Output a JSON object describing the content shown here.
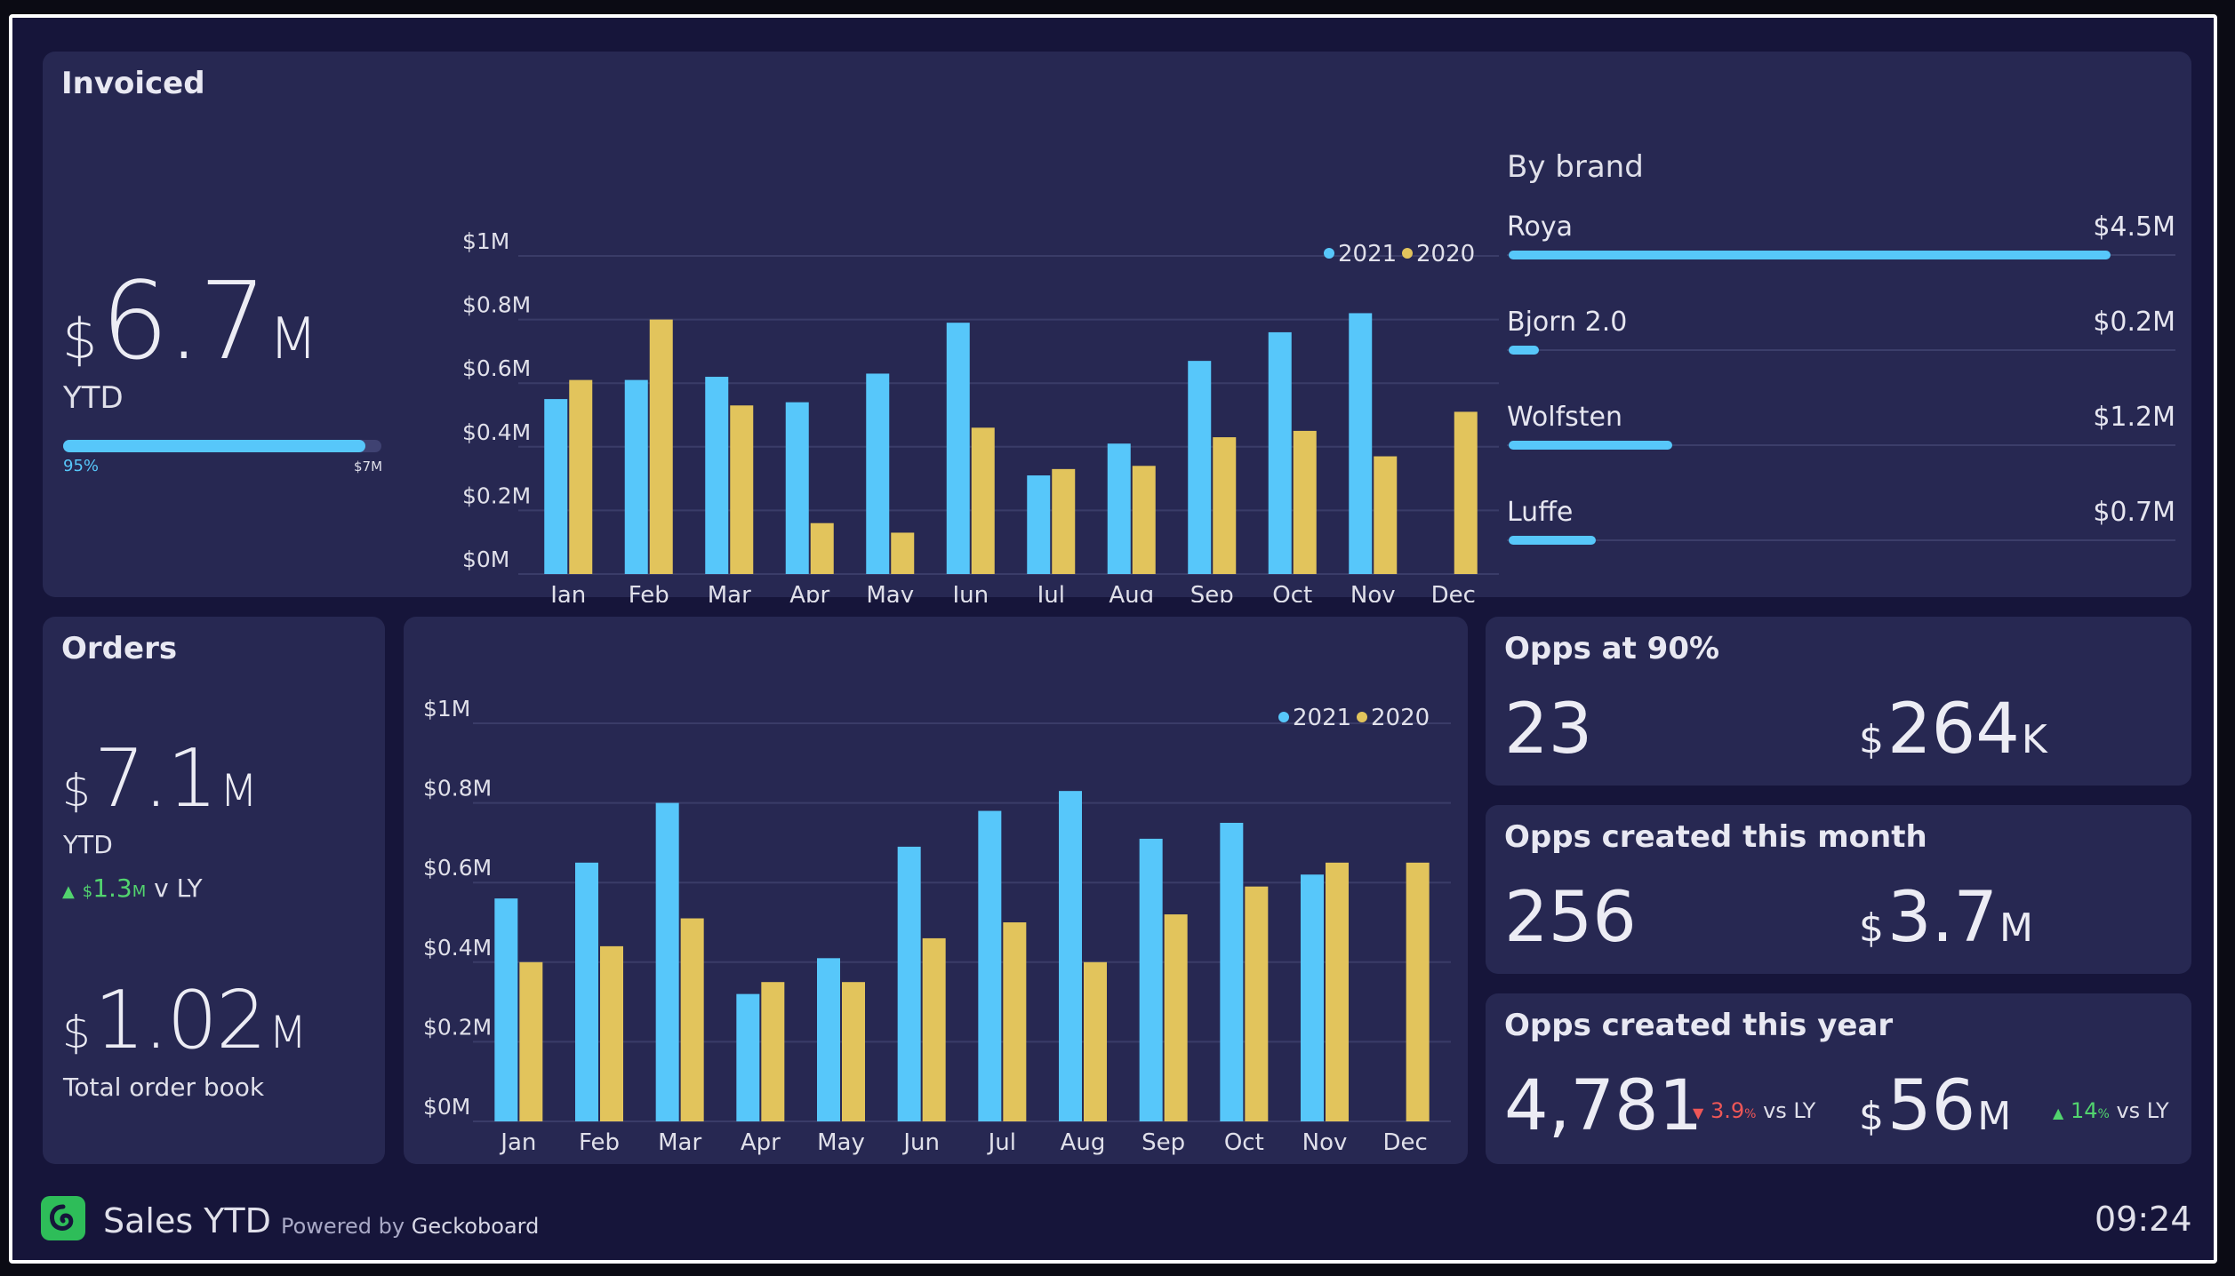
{
  "colors": {
    "c2021": "#57c7fa",
    "c2020": "#e2c45c",
    "up": "#52d46e",
    "down": "#ef5757",
    "bg": "#16153a",
    "panel": "#272852"
  },
  "invoiced": {
    "title": "Invoiced",
    "ytd": {
      "currency": "$",
      "value": "6.7",
      "unit": "M",
      "label": "YTD"
    },
    "progress": {
      "percent_label": "95%",
      "target_label": "$7M",
      "fraction": 0.95
    }
  },
  "brands": {
    "title": "By brand",
    "items": [
      {
        "name": "Roya",
        "value": "$4.5M",
        "fraction": 0.9
      },
      {
        "name": "Bjorn 2.0",
        "value": "$0.2M",
        "fraction": 0.045
      },
      {
        "name": "Wolfsten",
        "value": "$1.2M",
        "fraction": 0.245
      },
      {
        "name": "Luffe",
        "value": "$0.7M",
        "fraction": 0.13
      }
    ]
  },
  "orders": {
    "title": "Orders",
    "ytd": {
      "currency": "$",
      "value": "7.1",
      "unit": "M",
      "label": "YTD"
    },
    "delta": {
      "arrow": "▲",
      "currency": "$",
      "value": "1.3",
      "unit": "M",
      "suffix": "v LY"
    },
    "book": {
      "currency": "$",
      "value": "1.02",
      "unit": "M",
      "label": "Total order book"
    }
  },
  "opps90": {
    "title": "Opps at 90%",
    "count": "23",
    "currency": "$",
    "value": "264",
    "unit": "K"
  },
  "oppsMonth": {
    "title": "Opps created this month",
    "count": "256",
    "currency": "$",
    "value": "3.7",
    "unit": "M"
  },
  "oppsYear": {
    "title": "Opps created this year",
    "count": "4,781",
    "count_delta": {
      "arrow": "▼",
      "value": "3.9",
      "unit": "%",
      "suffix": "vs LY"
    },
    "currency": "$",
    "value": "56",
    "unit": "M",
    "value_delta": {
      "arrow": "▲",
      "value": "14",
      "unit": "%",
      "suffix": "vs LY"
    }
  },
  "footer": {
    "title": "Sales YTD",
    "powered_prefix": "Powered by",
    "powered_brand": "Geckoboard",
    "time": "09:24"
  },
  "chart_data": [
    {
      "type": "bar",
      "categories": [
        "Jan",
        "Feb",
        "Mar",
        "Apr",
        "May",
        "Jun",
        "Jul",
        "Aug",
        "Sep",
        "Oct",
        "Nov",
        "Dec"
      ],
      "series": [
        {
          "name": "2021",
          "values": [
            0.55,
            0.61,
            0.62,
            0.54,
            0.63,
            0.79,
            0.31,
            0.41,
            0.67,
            0.76,
            0.82,
            null
          ]
        },
        {
          "name": "2020",
          "values": [
            0.61,
            0.8,
            0.53,
            0.16,
            0.13,
            0.46,
            0.33,
            0.34,
            0.43,
            0.45,
            0.37,
            0.51
          ]
        }
      ],
      "yticks": [
        "$0M",
        "$0.2M",
        "$0.4M",
        "$0.6M",
        "$0.8M",
        "$1M"
      ],
      "ylim": [
        0,
        1
      ],
      "legend": "top-right",
      "grid": true
    },
    {
      "type": "bar",
      "categories": [
        "Jan",
        "Feb",
        "Mar",
        "Apr",
        "May",
        "Jun",
        "Jul",
        "Aug",
        "Sep",
        "Oct",
        "Nov",
        "Dec"
      ],
      "series": [
        {
          "name": "2021",
          "values": [
            0.56,
            0.65,
            0.8,
            0.32,
            0.41,
            0.69,
            0.78,
            0.83,
            0.71,
            0.75,
            0.62,
            null
          ]
        },
        {
          "name": "2020",
          "values": [
            0.4,
            0.44,
            0.51,
            0.35,
            0.35,
            0.46,
            0.5,
            0.4,
            0.52,
            0.59,
            0.65,
            0.65
          ]
        }
      ],
      "yticks": [
        "$0M",
        "$0.2M",
        "$0.4M",
        "$0.6M",
        "$0.8M",
        "$1M"
      ],
      "ylim": [
        0,
        1
      ],
      "legend": "top-right",
      "grid": true
    }
  ]
}
